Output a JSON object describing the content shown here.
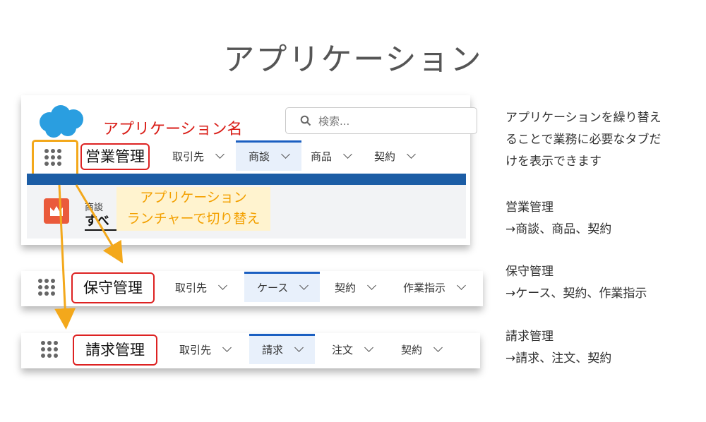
{
  "title": "アプリケーション",
  "screen1": {
    "search_placeholder": "検索...",
    "app_name_callout": "アプリケーション名",
    "app_name": "営業管理",
    "tabs": [
      "取引先",
      "商談",
      "商品",
      "契約"
    ],
    "active_tab_index": 1,
    "record_label": "商談",
    "record_title": "すべ",
    "launcher_tooltip_line1": "アプリケーション",
    "launcher_tooltip_line2": "ランチャーで切り替え"
  },
  "screen2": {
    "app_name": "保守管理",
    "tabs": [
      "取引先",
      "ケース",
      "契約",
      "作業指示"
    ],
    "active_tab_index": 1
  },
  "screen3": {
    "app_name": "請求管理",
    "tabs": [
      "取引先",
      "請求",
      "注文",
      "契約"
    ],
    "active_tab_index": 1
  },
  "notes": {
    "intro": [
      "アプリケーションを繰り替え",
      "ることで業務に必要なタブだ",
      "けを表示できます"
    ],
    "sales": [
      "営業管理",
      "→商談、商品、契約"
    ],
    "maintenance": [
      "保守管理",
      "→ケース、契約、作業指示"
    ],
    "billing": [
      "請求管理",
      "→請求、注文、契約"
    ]
  },
  "colors": {
    "callout_red": "#d91e18",
    "launcher_orange": "#f3a81b",
    "active_tab_blue": "#1b5fc1",
    "salesforce_blue": "#2a9ee0",
    "band_blue": "#1c5da5"
  }
}
